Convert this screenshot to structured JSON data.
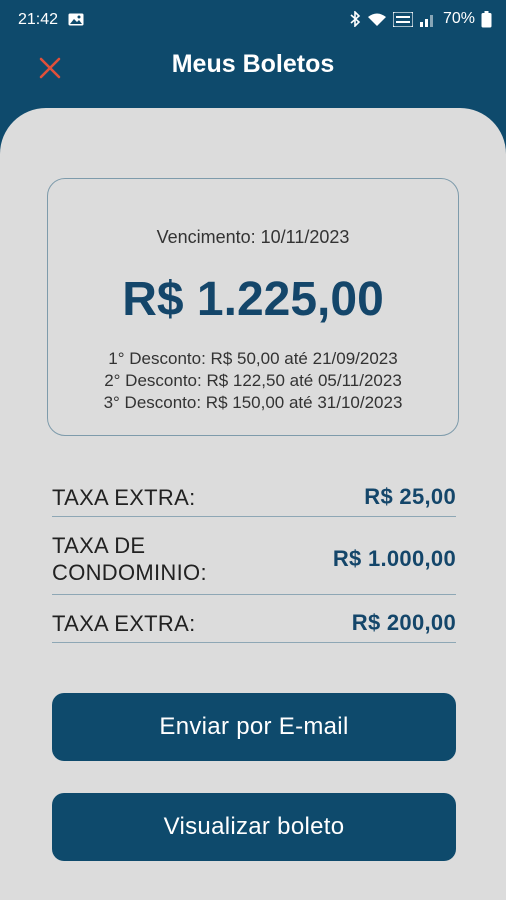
{
  "status_bar": {
    "time": "21:42",
    "battery": "70%",
    "icons": [
      "gallery-icon",
      "bluetooth-icon",
      "wifi-icon",
      "volte-icon",
      "signal-icon",
      "battery-icon"
    ]
  },
  "header": {
    "title": "Meus Boletos",
    "close_icon": "close-icon"
  },
  "summary": {
    "due_date": "Vencimento: 10/11/2023",
    "total": "R$ 1.225,00",
    "discounts": [
      "1° Desconto: R$ 50,00 até 21/09/2023",
      "2° Desconto: R$ 122,50 até 05/11/2023",
      "3° Desconto: R$ 150,00 até 31/10/2023"
    ]
  },
  "fees": [
    {
      "label": "TAXA EXTRA:",
      "value": "R$ 25,00"
    },
    {
      "label": "TAXA DE CONDOMINIO:",
      "value": "R$ 1.000,00"
    },
    {
      "label": "TAXA EXTRA:",
      "value": "R$ 200,00"
    }
  ],
  "buttons": {
    "email": "Enviar por E-mail",
    "view": "Visualizar boleto"
  },
  "colors": {
    "header_bg": "#0e4a6c",
    "content_bg": "#dcdcdc",
    "accent": "#14466a",
    "close": "#e0503a"
  }
}
